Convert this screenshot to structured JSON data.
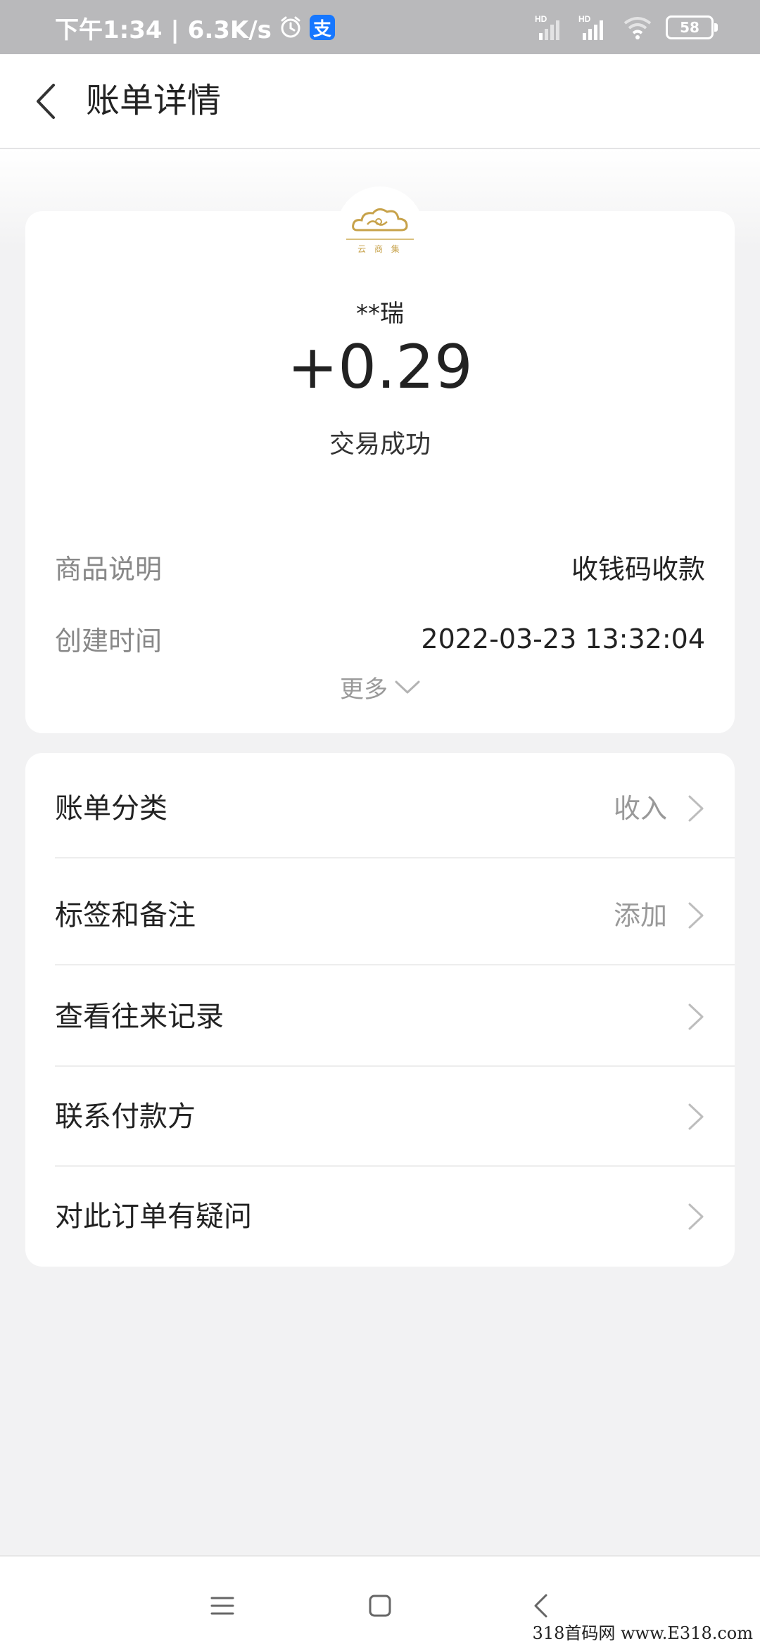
{
  "status_bar": {
    "time_speed": "下午1:34 | 6.3K/s",
    "alipay_glyph": "支",
    "signal_1_label": "HD",
    "signal_2_label": "HD",
    "battery": "58"
  },
  "header": {
    "title": "账单详情"
  },
  "transaction": {
    "logo_caption": "云 商 集",
    "payer": "**瑞",
    "amount": "+0.29",
    "status": "交易成功",
    "details": [
      {
        "label": "商品说明",
        "value": "收钱码收款"
      },
      {
        "label": "创建时间",
        "value": "2022-03-23 13:32:04"
      }
    ],
    "more_label": "更多"
  },
  "menu": [
    {
      "label": "账单分类",
      "value": "收入"
    },
    {
      "label": "标签和备注",
      "value": "添加"
    },
    {
      "label": "查看往来记录",
      "value": ""
    },
    {
      "label": "联系付款方",
      "value": ""
    },
    {
      "label": "对此订单有疑问",
      "value": ""
    }
  ],
  "watermark": "318首码网 www.E318.com",
  "colors": {
    "accent_alipay": "#1677ff",
    "logo_gold": "#c7a24a",
    "background": "#f2f2f3"
  }
}
